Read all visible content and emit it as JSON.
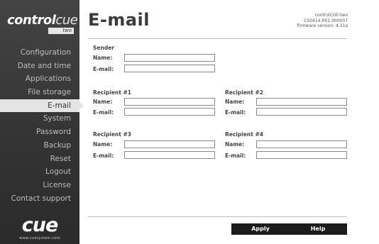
{
  "logo": {
    "main_bold": "control",
    "main_thin": "cue",
    "sub": "two"
  },
  "nav": {
    "items": [
      {
        "label": "Configuration"
      },
      {
        "label": "Date and time"
      },
      {
        "label": "Applications"
      },
      {
        "label": "File storage"
      },
      {
        "label": "E-mail",
        "active": true
      },
      {
        "label": "System"
      },
      {
        "label": "Password"
      },
      {
        "label": "Backup"
      },
      {
        "label": "Reset"
      },
      {
        "label": "Logout"
      },
      {
        "label": "License"
      },
      {
        "label": "Contact support"
      }
    ]
  },
  "brand": {
    "word": "cue",
    "url": "www.cuesystem.com"
  },
  "header": {
    "title": "E-mail",
    "device_name": "controlCUE-two",
    "serial": "CS0414.R01.000007",
    "firmware": "firmware version: 4.31a"
  },
  "form": {
    "sender": {
      "title": "Sender",
      "name_label": "Name:",
      "email_label": "E-mail:",
      "name_value": "",
      "email_value": ""
    },
    "recipient1": {
      "title": "Recipient #1",
      "name_label": "Name:",
      "email_label": "E-mail:",
      "name_value": "",
      "email_value": ""
    },
    "recipient2": {
      "title": "Recipient #2",
      "name_label": "Name:",
      "email_label": "E-mail:",
      "name_value": "",
      "email_value": ""
    },
    "recipient3": {
      "title": "Recipient #3",
      "name_label": "Name:",
      "email_label": "E-mail:",
      "name_value": "",
      "email_value": ""
    },
    "recipient4": {
      "title": "Recipient #4",
      "name_label": "Name:",
      "email_label": "E-mail:",
      "name_value": "",
      "email_value": ""
    }
  },
  "buttons": {
    "apply": "Apply",
    "help": "Help"
  }
}
